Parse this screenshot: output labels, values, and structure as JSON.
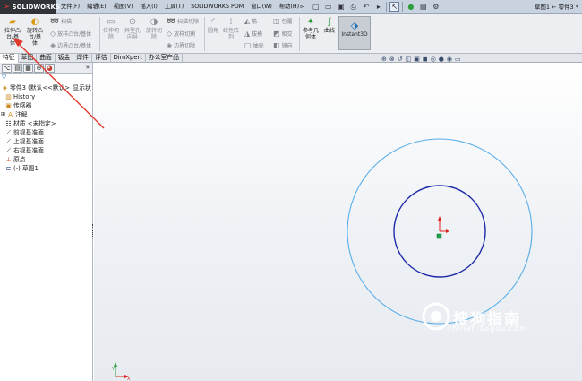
{
  "app": {
    "brand": "SOLIDWORKS",
    "doc_title": "草图1 ← 零件3 *"
  },
  "menus": [
    {
      "label": "文件(F)"
    },
    {
      "label": "编辑(E)"
    },
    {
      "label": "视图(V)"
    },
    {
      "label": "插入(I)"
    },
    {
      "label": "工具(T)"
    },
    {
      "label": "SOLIDWORKS PDM"
    },
    {
      "label": "窗口(W)"
    },
    {
      "label": "帮助(H)"
    }
  ],
  "ribbon": {
    "extrude_boss": "拉伸凸\n台/基\n体",
    "revolve_boss": "旋转凸\n台/基\n体",
    "sweep": "扫描",
    "loft_boss": "放样凸台/基体",
    "boundary_boss": "边界凸台/基体",
    "extrude_cut": "拉伸切\n除",
    "hole_wizard": "异型孔\n向导",
    "revolve_cut": "旋转切\n除",
    "swept_cut": "扫描切除",
    "lofted_cut": "放样切割",
    "boundary_cut": "边界切除",
    "fillet": "圆角",
    "linear_pattern": "线性阵\n列",
    "rib": "筋",
    "draft": "拔模",
    "shell": "抽壳",
    "wrap": "包覆",
    "intersect": "相交",
    "mirror": "镜向",
    "reference_geometry": "参考几\n何体",
    "curves": "曲线",
    "instant3d": "Instant3D"
  },
  "tabs": [
    {
      "label": "特征"
    },
    {
      "label": "草图"
    },
    {
      "label": "曲面"
    },
    {
      "label": "钣金"
    },
    {
      "label": "焊件"
    },
    {
      "label": "评估"
    },
    {
      "label": "DimXpert"
    },
    {
      "label": "办公室产品"
    }
  ],
  "tree": {
    "root": "零件3 (默认<<默认>_显示状",
    "items": [
      {
        "label": "History"
      },
      {
        "label": "传感器"
      },
      {
        "label": "注解"
      },
      {
        "label": "材质 <未指定>"
      },
      {
        "label": "前视基准面"
      },
      {
        "label": "上视基准面"
      },
      {
        "label": "右视基准面"
      },
      {
        "label": "原点"
      },
      {
        "label": "(-) 草图1"
      }
    ],
    "expand_label": "»"
  },
  "watermark": {
    "text": "搜狗指南",
    "url": "zhinan.sogou.com"
  },
  "colors": {
    "outer_circle": "#5aaee8",
    "inner_circle": "#1e2aa8",
    "arrow": "#e0392b",
    "title_bar": "#c9d3e0"
  }
}
